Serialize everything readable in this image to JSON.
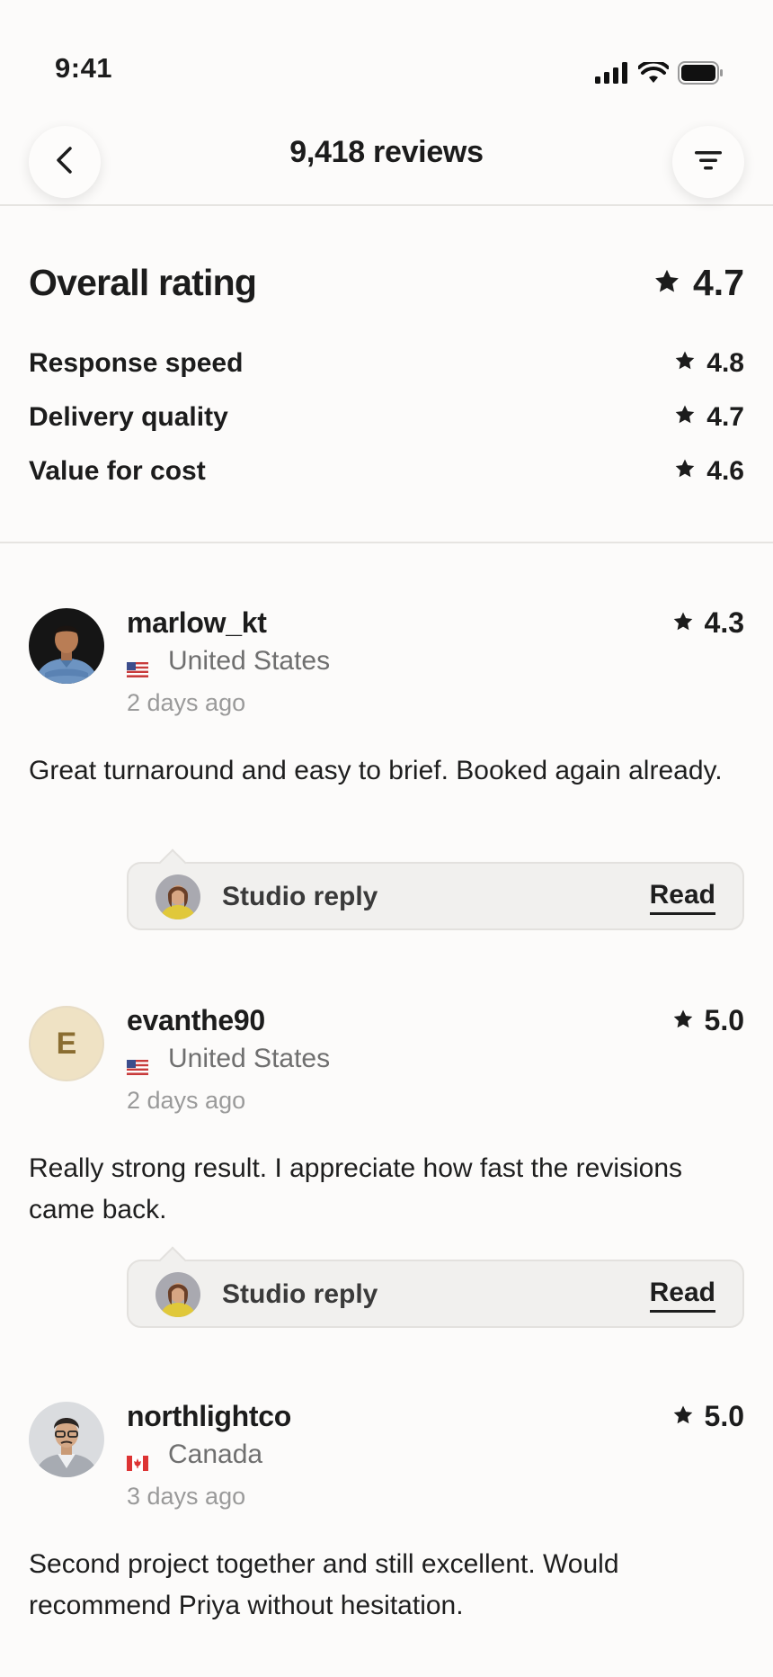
{
  "status": {
    "time": "9:41"
  },
  "header": {
    "title": "9,418 reviews"
  },
  "summary": {
    "overall_label": "Overall rating",
    "overall_score": "4.7",
    "categories": [
      {
        "label": "Response speed",
        "score": "4.8"
      },
      {
        "label": "Delivery quality",
        "score": "4.7"
      },
      {
        "label": "Value for cost",
        "score": "4.6"
      }
    ]
  },
  "reviews": [
    {
      "username": "marlow_kt",
      "score": "4.3",
      "country": "United States",
      "time": "2 days ago",
      "text": "Great turnaround and easy to brief. Booked again already.",
      "reply_label": "Studio reply",
      "reply_action": "Read"
    },
    {
      "username": "evanthe90",
      "avatar_letter": "E",
      "score": "5.0",
      "country": "United States",
      "time": "2 days ago",
      "text": "Really strong result. I appreciate how fast the revisions came back.",
      "reply_label": "Studio reply",
      "reply_action": "Read"
    },
    {
      "username": "northlightco",
      "score": "5.0",
      "country": "Canada",
      "time": "3 days ago",
      "text": "Second project together and still excellent. Would recommend Priya without hesitation."
    }
  ],
  "icons": {
    "back": "chevron-left-icon",
    "filter": "filter-icon",
    "star": "star-icon",
    "signal": "cellular-signal-icon",
    "wifi": "wifi-icon",
    "battery": "battery-icon"
  },
  "colors": {
    "background": "#fcfbfa",
    "text": "#1c1c1c",
    "muted": "#6f6f6f",
    "reply_bg": "#f1f0ee",
    "letter_avatar_bg": "#efe2c4"
  }
}
